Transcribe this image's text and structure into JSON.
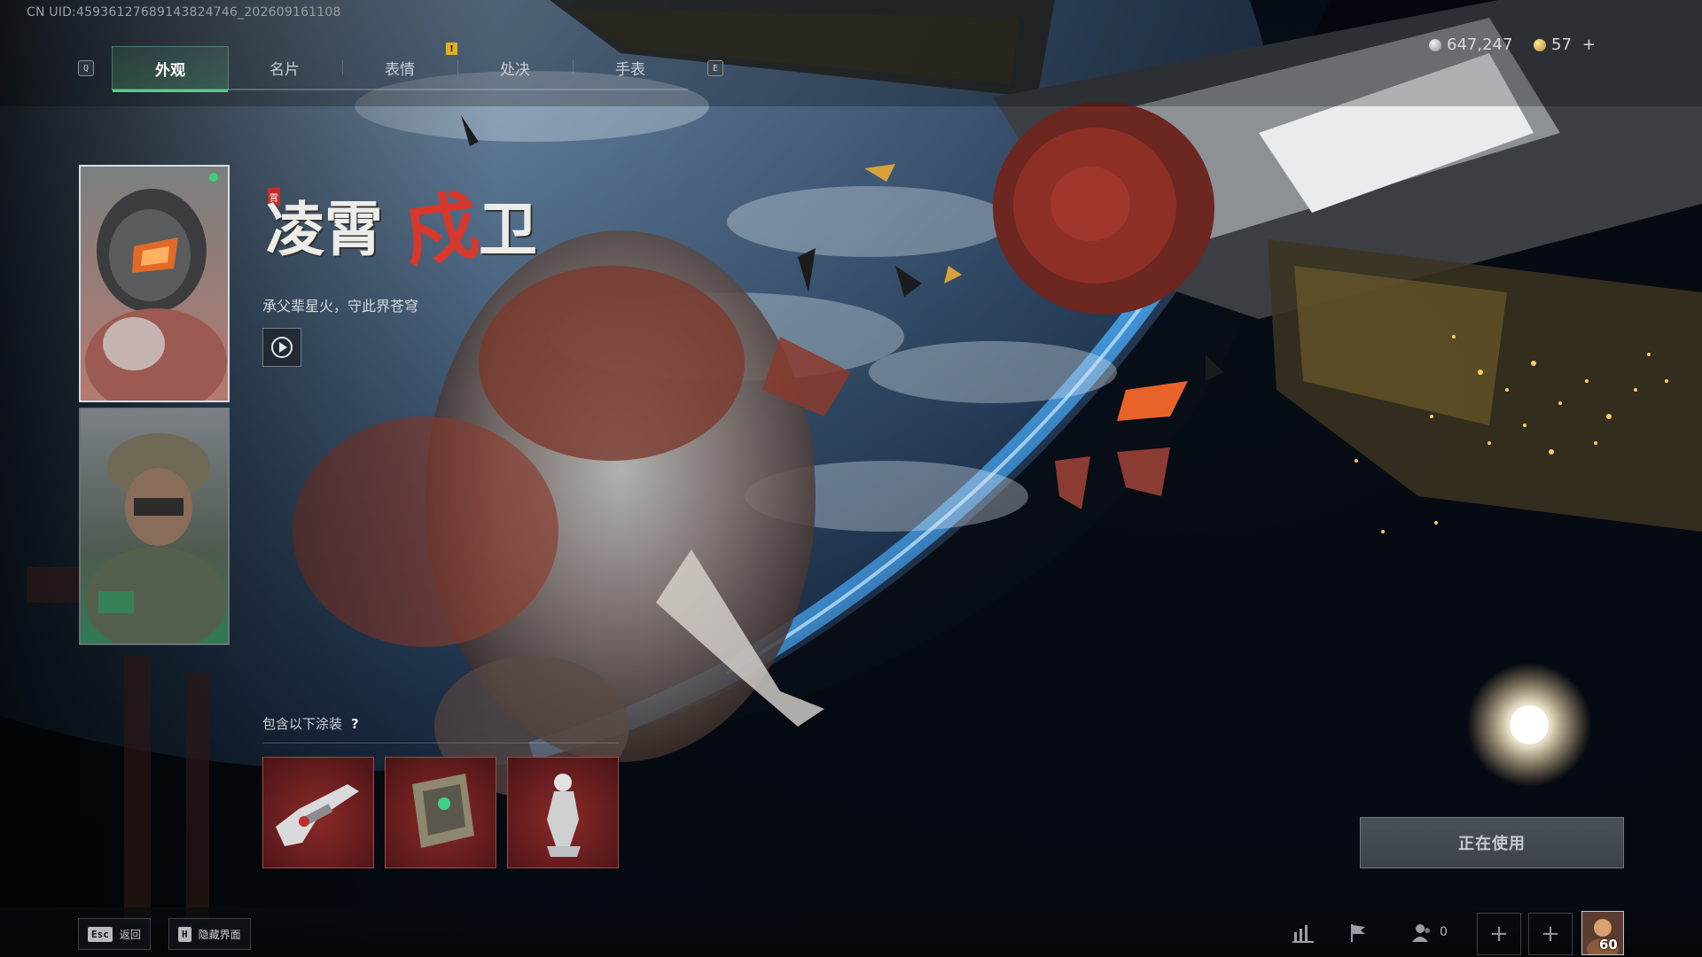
{
  "uid_text": "CN UID:45936127689143824746_202609161108",
  "tabs": {
    "prev_key": "Q",
    "next_key": "E",
    "items": [
      "外观",
      "名片",
      "表情",
      "处决",
      "手表"
    ],
    "active_index": 0,
    "alert_mark": "!"
  },
  "currency": {
    "primary_amount": "647,247",
    "premium_amount": "57",
    "add_symbol": "+"
  },
  "skin": {
    "title_part1": "凌霄",
    "title_part2": "戍",
    "title_part3": "卫",
    "seal_char": "霄",
    "subtitle": "承父辈星火，守此界苍穹"
  },
  "includes": {
    "label": "包含以下涂装",
    "help": "?",
    "items": [
      "weapon-skin",
      "gadget-skin",
      "figure-skin"
    ]
  },
  "action_button": "正在使用",
  "bottom": {
    "back": {
      "key": "Esc",
      "label": "返回"
    },
    "hide": {
      "key": "H",
      "label": "隐藏界面"
    },
    "party_count": "0",
    "add_symbol": "+",
    "level": "60"
  },
  "colors": {
    "accent_green": "#53d08a",
    "title_red": "#d8372c",
    "alert_yellow": "#e0b020"
  }
}
